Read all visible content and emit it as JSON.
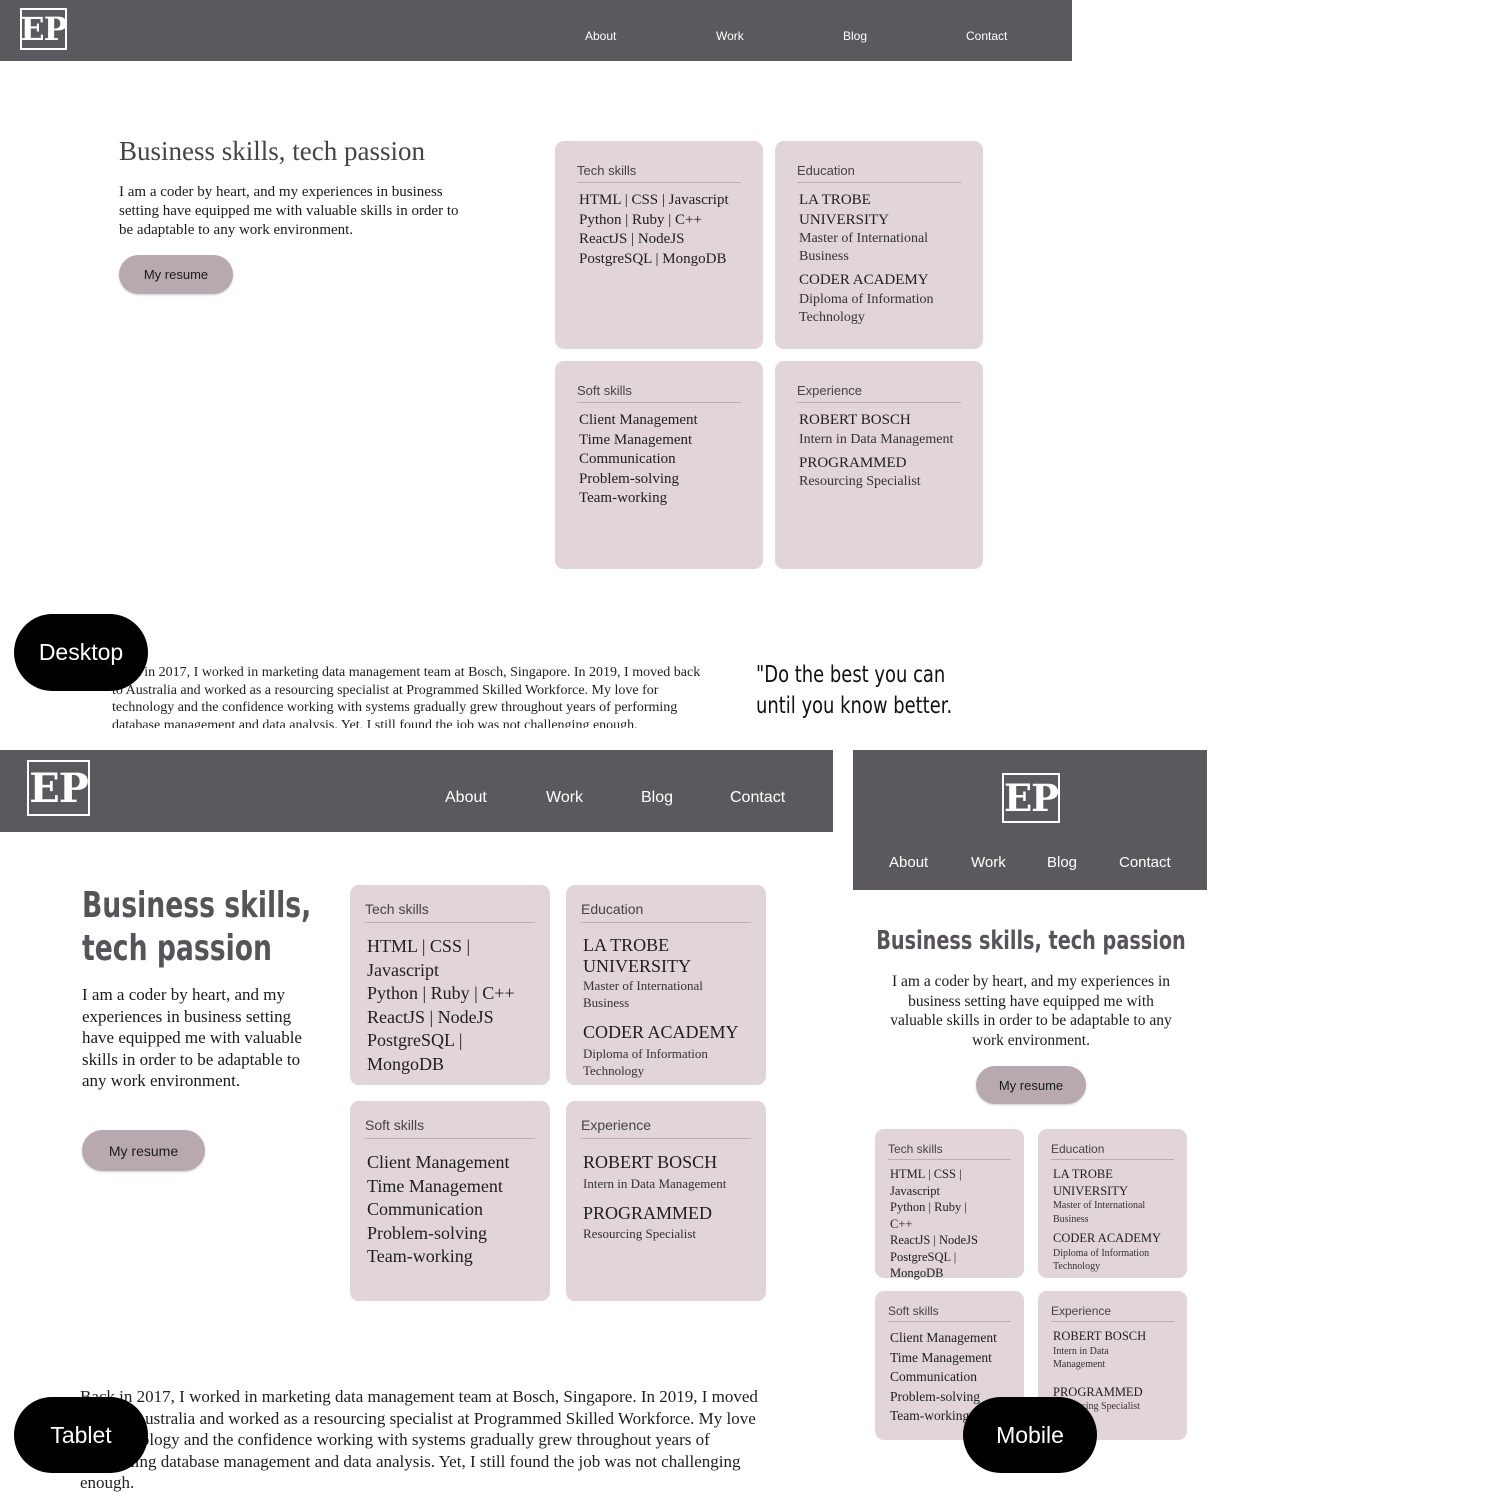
{
  "logo_text": "EP",
  "nav": [
    "About",
    "Work",
    "Blog",
    "Contact"
  ],
  "hero": {
    "heading": "Business skills, tech passion",
    "heading_line1": "Business skills,",
    "heading_line2": "tech passion",
    "intro": "I am a coder by heart, and my experiences in business setting have equipped me with valuable skills in order to be adaptable to any work environment.",
    "button": "My resume"
  },
  "cards": {
    "tech": {
      "title": "Tech skills",
      "items": [
        "HTML | CSS | Javascript",
        "Python | Ruby | C++",
        "ReactJS | NodeJS",
        "PostgreSQL | MongoDB"
      ]
    },
    "education": {
      "title": "Education",
      "entries": [
        {
          "org": "LA TROBE UNIVERSITY",
          "role": "Master of International Business"
        },
        {
          "org": "CODER ACADEMY",
          "role": "Diploma of Information Technology"
        }
      ]
    },
    "soft": {
      "title": "Soft skills",
      "items": [
        "Client Management",
        "Time Management",
        "Communication",
        "Problem-solving",
        "Team-working"
      ]
    },
    "experience": {
      "title": "Experience",
      "entries": [
        {
          "org": "ROBERT BOSCH",
          "role": "Intern in Data Management"
        },
        {
          "org": "PROGRAMMED",
          "role": "Resourcing Specialist"
        }
      ]
    }
  },
  "about_paragraph": "Back in 2017, I worked in marketing data management team at Bosch, Singapore. In 2019, I moved back to Australia and worked as a resourcing specialist at Programmed Skilled Workforce. My love for technology and the confidence working with systems gradually grew throughout years of performing database management and data analysis. Yet, I still found the job was not challenging enough.",
  "quote_line1": "\"Do the best you can",
  "quote_line2": "until you know better.",
  "labels": {
    "desktop": "Desktop",
    "tablet": "Tablet",
    "mobile": "Mobile"
  },
  "colors": {
    "nav_bg": "#5b595d",
    "card_bg": "#e2d5da",
    "button_bg": "#b8a9b1",
    "label_bg": "#000000"
  }
}
